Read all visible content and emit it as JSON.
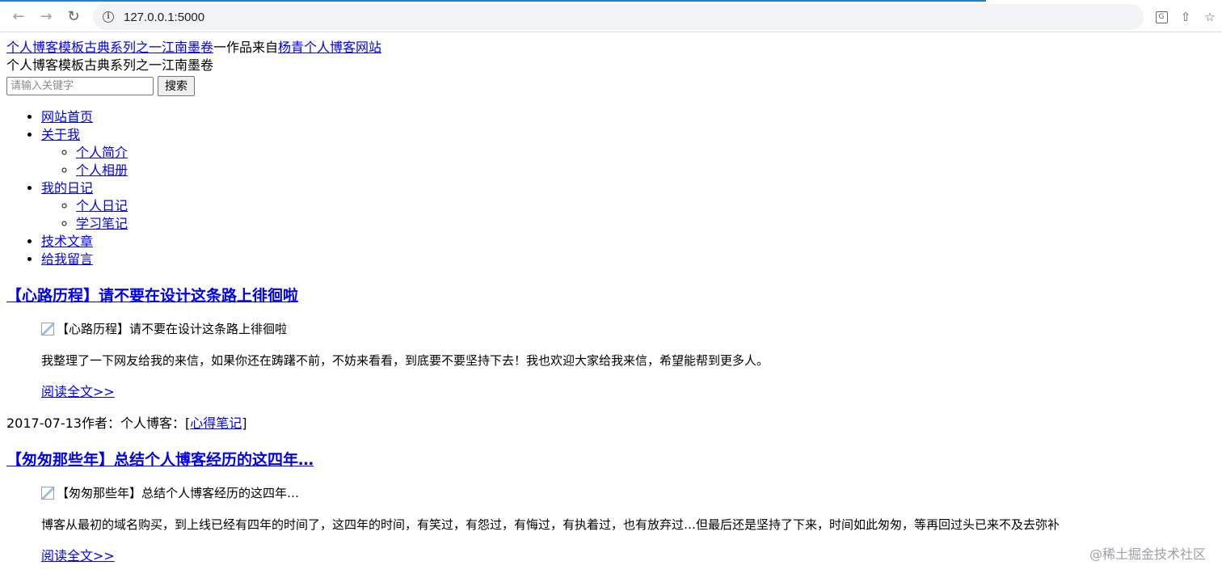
{
  "browser": {
    "url": "127.0.0.1:5000"
  },
  "header": {
    "site_link": "个人博客模板古典系列之一江南墨卷",
    "from_text": "一作品来自",
    "author_link": "杨青个人博客网站",
    "subtitle": "个人博客模板古典系列之一江南墨卷"
  },
  "search": {
    "placeholder": "请输入关键字",
    "button_label": "搜索"
  },
  "nav": {
    "home": "网站首页",
    "about": "关于我",
    "about_children": [
      "个人简介",
      "个人相册"
    ],
    "diary": "我的日记",
    "diary_children": [
      "个人日记",
      "学习笔记"
    ],
    "tech": "技术文章",
    "message": "给我留言"
  },
  "articles": [
    {
      "title": "【心路历程】请不要在设计这条路上徘徊啦",
      "img_alt": "【心路历程】请不要在设计这条路上徘徊啦",
      "desc": "我整理了一下网友给我的来信，如果你还在踌躇不前，不妨来看看，到底要不要坚持下去！我也欢迎大家给我来信，希望能帮到更多人。",
      "more": "阅读全文>>",
      "meta_prefix": "2017-07-13作者：个人博客：[",
      "category": "心得笔记",
      "meta_suffix": "]"
    },
    {
      "title": "【匆匆那些年】总结个人博客经历的这四年…",
      "img_alt": "【匆匆那些年】总结个人博客经历的这四年…",
      "desc": "博客从最初的域名购买，到上线已经有四年的时间了，这四年的时间，有笑过，有怨过，有悔过，有执着过，也有放弃过…但最后还是坚持了下来，时间如此匆匆，等再回过头已来不及去弥补",
      "more": "阅读全文>>"
    }
  ],
  "watermark": "@稀土掘金技术社区"
}
